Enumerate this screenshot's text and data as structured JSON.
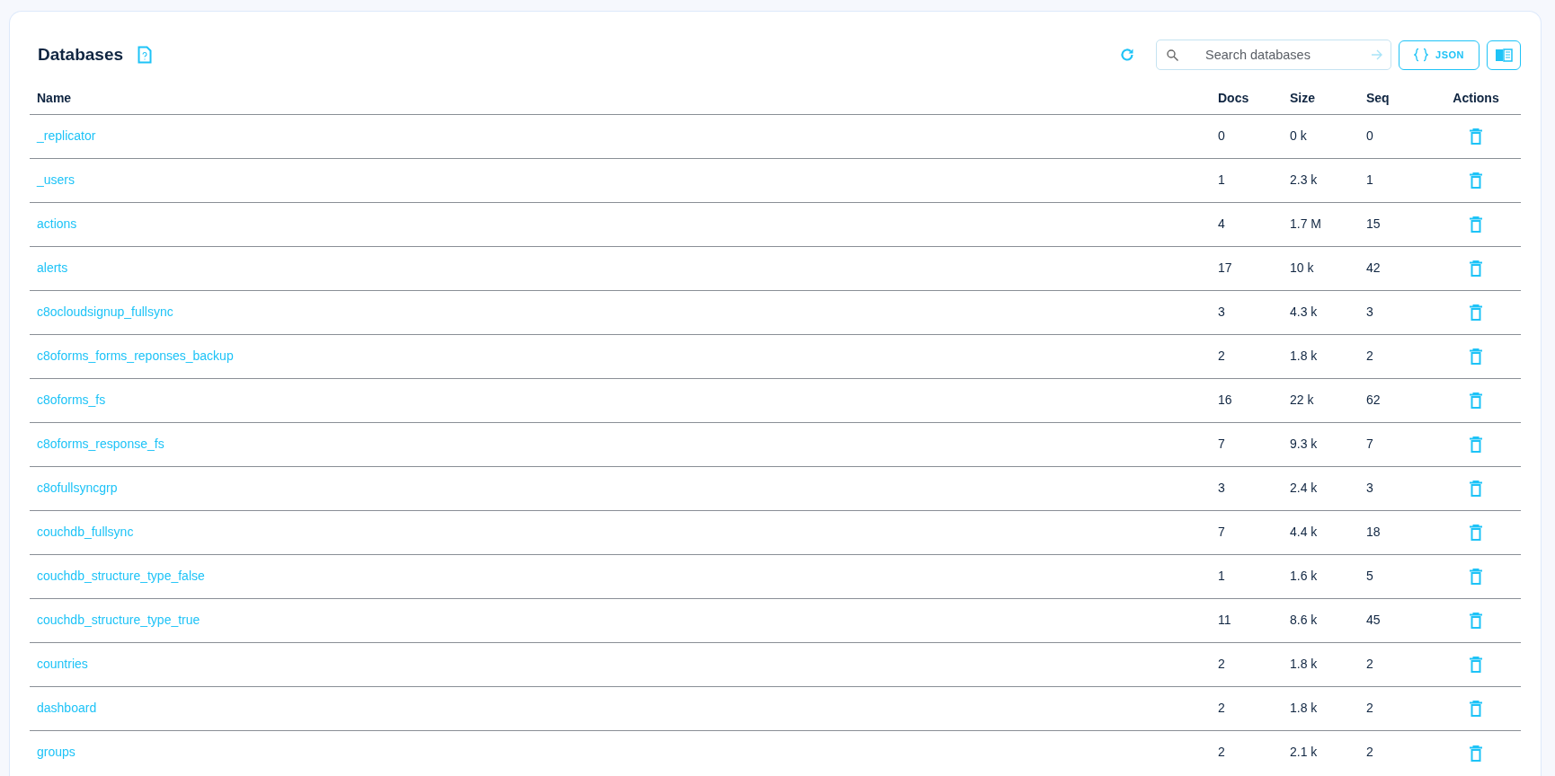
{
  "title": "Databases",
  "search": {
    "placeholder": "Search databases"
  },
  "buttons": [
    {
      "kind": "json",
      "label": "JSON"
    },
    {
      "kind": "docs"
    }
  ],
  "table": {
    "columns": [
      "Name",
      "Docs",
      "Size",
      "Seq",
      "Actions"
    ],
    "rows": [
      {
        "name": "_replicator",
        "docs": "0",
        "size": "0 k",
        "seq": "0"
      },
      {
        "name": "_users",
        "docs": "1",
        "size": "2.3 k",
        "seq": "1"
      },
      {
        "name": "actions",
        "docs": "4",
        "size": "1.7 M",
        "seq": "15"
      },
      {
        "name": "alerts",
        "docs": "17",
        "size": "10 k",
        "seq": "42"
      },
      {
        "name": "c8ocloudsignup_fullsync",
        "docs": "3",
        "size": "4.3 k",
        "seq": "3"
      },
      {
        "name": "c8oforms_forms_reponses_backup",
        "docs": "2",
        "size": "1.8 k",
        "seq": "2"
      },
      {
        "name": "c8oforms_fs",
        "docs": "16",
        "size": "22 k",
        "seq": "62"
      },
      {
        "name": "c8oforms_response_fs",
        "docs": "7",
        "size": "9.3 k",
        "seq": "7"
      },
      {
        "name": "c8ofullsyncgrp",
        "docs": "3",
        "size": "2.4 k",
        "seq": "3"
      },
      {
        "name": "couchdb_fullsync",
        "docs": "7",
        "size": "4.4 k",
        "seq": "18"
      },
      {
        "name": "couchdb_structure_type_false",
        "docs": "1",
        "size": "1.6 k",
        "seq": "5"
      },
      {
        "name": "couchdb_structure_type_true",
        "docs": "11",
        "size": "8.6 k",
        "seq": "45"
      },
      {
        "name": "countries",
        "docs": "2",
        "size": "1.8 k",
        "seq": "2"
      },
      {
        "name": "dashboard",
        "docs": "2",
        "size": "1.8 k",
        "seq": "2"
      },
      {
        "name": "groups",
        "docs": "2",
        "size": "2.1 k",
        "seq": "2"
      }
    ]
  }
}
